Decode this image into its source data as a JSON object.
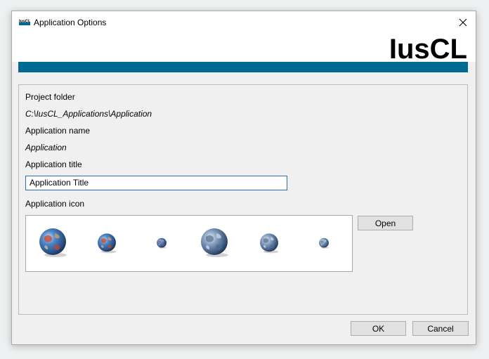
{
  "window": {
    "title": "Application Options",
    "brand": "IusCL",
    "accent_color": "#006a93"
  },
  "titlebar": {
    "app_icon": "iuscl-app-icon",
    "close_icon": "close-icon"
  },
  "form": {
    "project_folder_label": "Project folder",
    "project_folder_value": "C:\\IusCL_Applications\\Application",
    "application_name_label": "Application name",
    "application_name_value": "Application",
    "application_title_label": "Application title",
    "application_title_value": "Application Title",
    "application_icon_label": "Application icon",
    "icon_sizes": [
      "globe-icon-large",
      "globe-icon-medium",
      "globe-icon-small",
      "globe-icon-large",
      "globe-icon-medium",
      "globe-icon-small"
    ],
    "open_button": "Open"
  },
  "footer": {
    "ok_button": "OK",
    "cancel_button": "Cancel"
  }
}
